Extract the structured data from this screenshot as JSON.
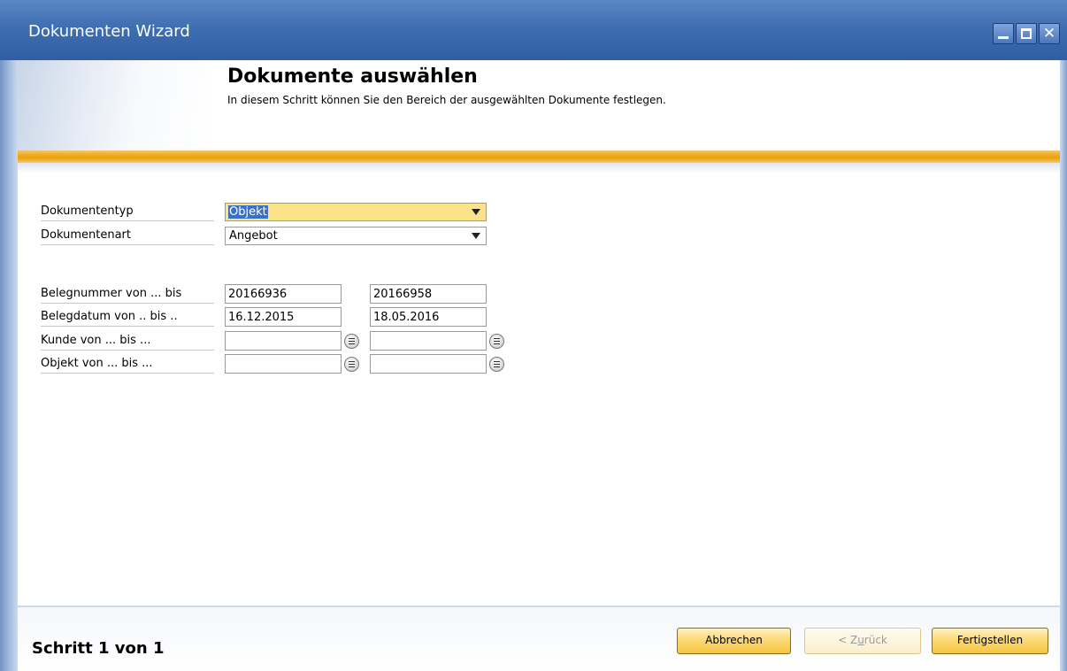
{
  "window": {
    "title": "Dokumenten Wizard",
    "controls": {
      "minimize": "minimize-icon",
      "maximize": "maximize-icon",
      "close": "close-icon",
      "close_glyph": "✕"
    }
  },
  "header": {
    "title": "Dokumente auswählen",
    "description": "In diesem Schritt können Sie den Bereich der ausgewählten Dokumente festlegen."
  },
  "form": {
    "dokumententyp": {
      "label": "Dokumententyp",
      "value": "Objekt"
    },
    "dokumentenart": {
      "label": "Dokumentenart",
      "value": "Angebot"
    },
    "belegnummer": {
      "label": "Belegnummer von ... bis",
      "from": "20166936",
      "to": "20166958"
    },
    "belegdatum": {
      "label": "Belegdatum von .. bis ..",
      "from": "16.12.2015",
      "to": "18.05.2016"
    },
    "kunde": {
      "label": "Kunde von ... bis ...",
      "from": "",
      "to": ""
    },
    "objekt": {
      "label": "Objekt von ... bis ...",
      "from": "",
      "to": ""
    }
  },
  "footer": {
    "step": "Schritt 1 von 1",
    "buttons": {
      "cancel": "Abbrechen",
      "back_pre": "< Z",
      "back_mnemonic": "u",
      "back_post": "rück",
      "finish": "Fertigstellen"
    }
  },
  "colors": {
    "titlebar": "#3f6eb2",
    "accent_orange": "#efaa18",
    "focus_field": "#fbe38a",
    "selection": "#3a70c8",
    "button_gold": "#fbd870"
  }
}
